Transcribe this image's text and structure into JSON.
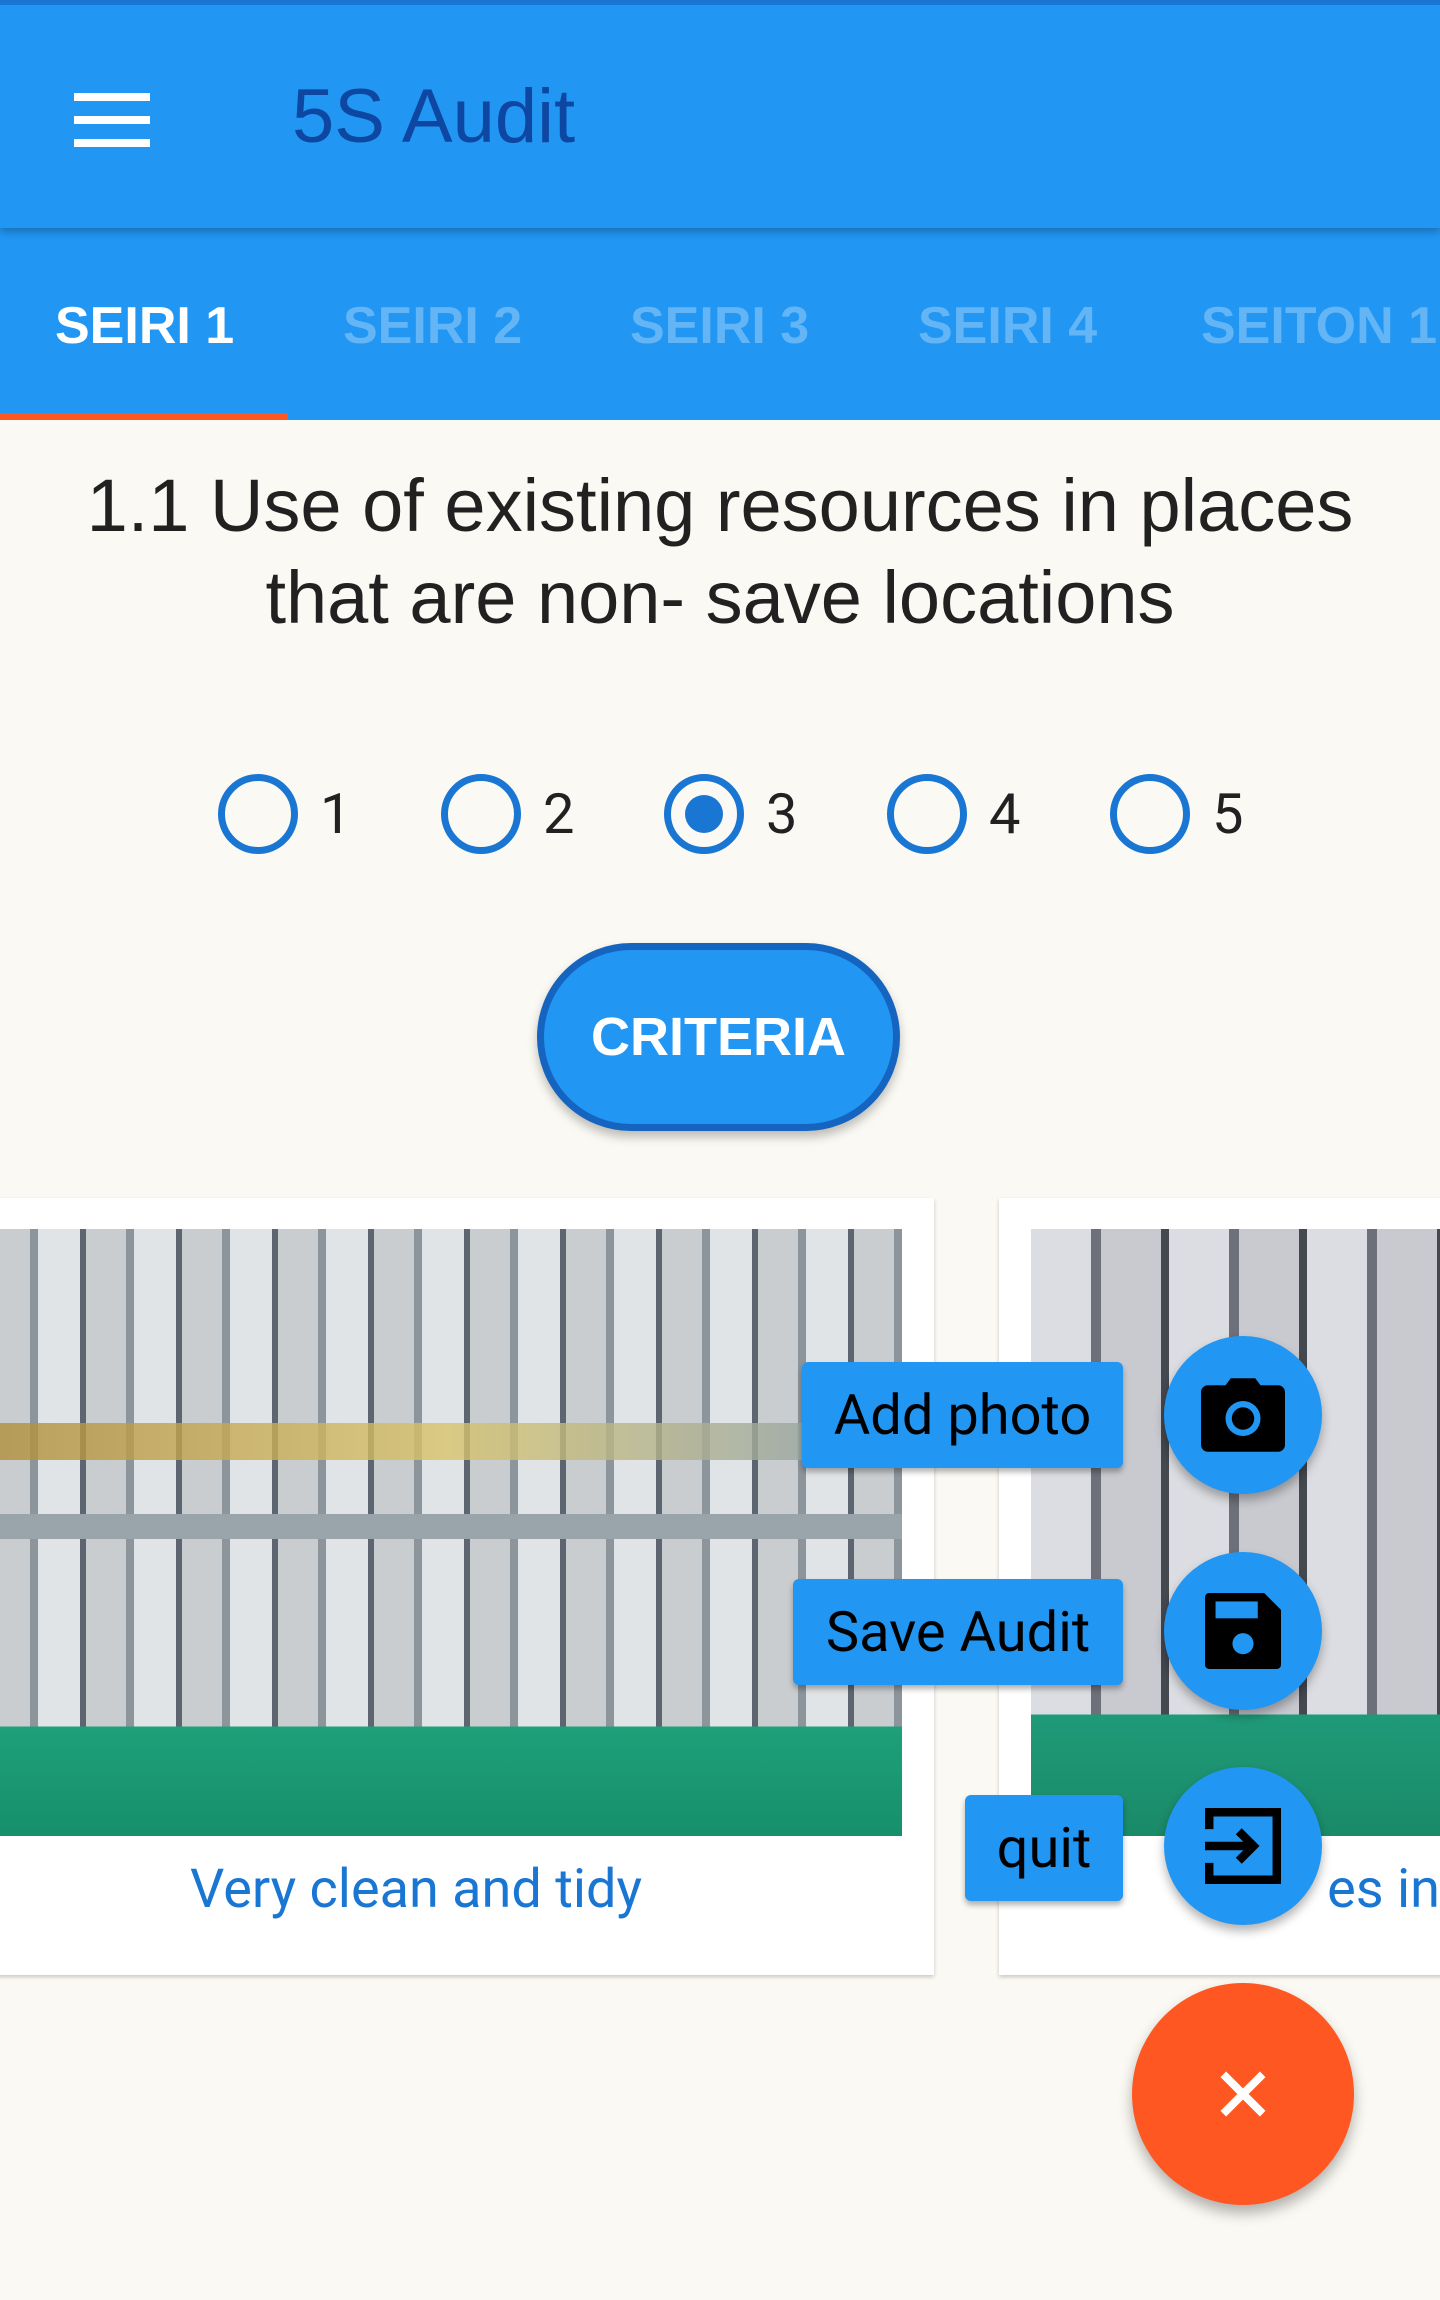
{
  "appbar": {
    "title": "5S Audit",
    "menu_icon": "hamburger-menu-icon"
  },
  "tabs": [
    {
      "label": "SEIRI 1",
      "active": true
    },
    {
      "label": "SEIRI 2"
    },
    {
      "label": "SEIRI 3"
    },
    {
      "label": "SEIRI 4"
    },
    {
      "label": "SEITON 1"
    }
  ],
  "question": {
    "line1": "1.1 Use of existing resources in places",
    "line2": "that are non- save locations"
  },
  "rating": {
    "options": [
      "1",
      "2",
      "3",
      "4",
      "5"
    ],
    "selected": "3"
  },
  "criteria_button": "CRITERIA",
  "cards": [
    {
      "caption": "Very clean and tidy"
    },
    {
      "caption": "es in"
    }
  ],
  "speed_dial": {
    "items": [
      {
        "label": "Add photo",
        "icon": "camera-icon"
      },
      {
        "label": "Save Audit",
        "icon": "save-icon"
      },
      {
        "label": "quit",
        "icon": "exit-icon"
      }
    ],
    "close_icon": "close-icon"
  },
  "colors": {
    "primary": "#2196f3",
    "accent": "#ff5722",
    "title": "#0d47a1",
    "link": "#1976d2"
  }
}
